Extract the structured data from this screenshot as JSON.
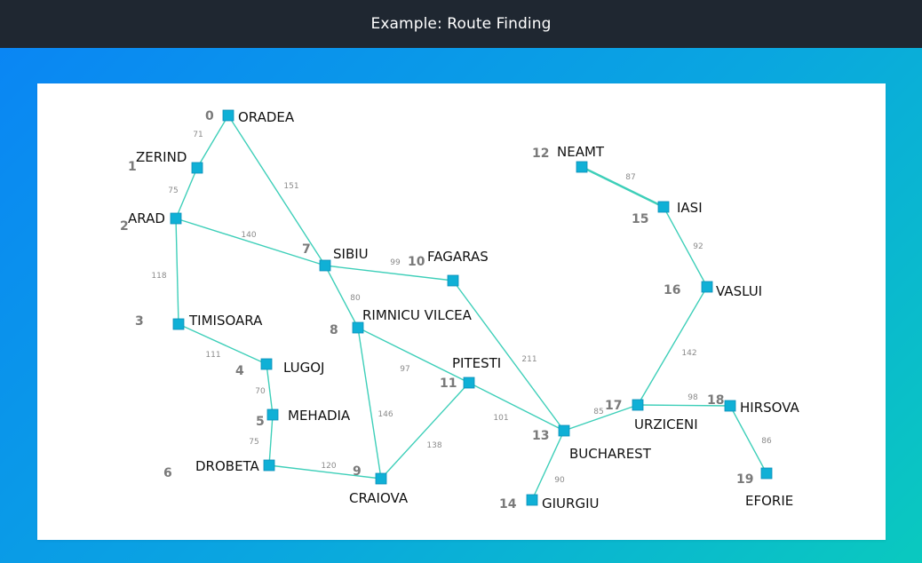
{
  "header": {
    "title": "Example: Route Finding"
  },
  "graph": {
    "nodes": [
      {
        "id": "0",
        "label": "ORADEA"
      },
      {
        "id": "1",
        "label": "ZERIND"
      },
      {
        "id": "2",
        "label": "ARAD"
      },
      {
        "id": "3",
        "label": "TIMISOARA"
      },
      {
        "id": "4",
        "label": "LUGOJ"
      },
      {
        "id": "5",
        "label": "MEHADIA"
      },
      {
        "id": "6",
        "label": "DROBETA"
      },
      {
        "id": "7",
        "label": "SIBIU"
      },
      {
        "id": "8",
        "label": "RIMNICU VILCEA"
      },
      {
        "id": "9",
        "label": "CRAIOVA"
      },
      {
        "id": "10",
        "label": "FAGARAS"
      },
      {
        "id": "11",
        "label": "PITESTI"
      },
      {
        "id": "12",
        "label": "NEAMT"
      },
      {
        "id": "13",
        "label": "BUCHAREST"
      },
      {
        "id": "14",
        "label": "GIURGIU"
      },
      {
        "id": "15",
        "label": "IASI"
      },
      {
        "id": "16",
        "label": "VASLUI"
      },
      {
        "id": "17",
        "label": "URZICENI"
      },
      {
        "id": "18",
        "label": "HIRSOVA"
      },
      {
        "id": "19",
        "label": "EFORIE"
      }
    ],
    "edges": [
      {
        "from": 0,
        "to": 1,
        "weight": "71"
      },
      {
        "from": 1,
        "to": 2,
        "weight": "75"
      },
      {
        "from": 0,
        "to": 7,
        "weight": "151"
      },
      {
        "from": 2,
        "to": 7,
        "weight": "140"
      },
      {
        "from": 2,
        "to": 3,
        "weight": "118"
      },
      {
        "from": 3,
        "to": 4,
        "weight": "111"
      },
      {
        "from": 4,
        "to": 5,
        "weight": "70"
      },
      {
        "from": 5,
        "to": 6,
        "weight": "75"
      },
      {
        "from": 6,
        "to": 9,
        "weight": "120"
      },
      {
        "from": 7,
        "to": 10,
        "weight": "99"
      },
      {
        "from": 7,
        "to": 8,
        "weight": "80"
      },
      {
        "from": 8,
        "to": 11,
        "weight": "97"
      },
      {
        "from": 8,
        "to": 9,
        "weight": "146"
      },
      {
        "from": 9,
        "to": 11,
        "weight": "138"
      },
      {
        "from": 11,
        "to": 13,
        "weight": "101"
      },
      {
        "from": 10,
        "to": 13,
        "weight": "211"
      },
      {
        "from": 13,
        "to": 14,
        "weight": "90"
      },
      {
        "from": 13,
        "to": 17,
        "weight": "85"
      },
      {
        "from": 17,
        "to": 18,
        "weight": "98"
      },
      {
        "from": 18,
        "to": 19,
        "weight": "86"
      },
      {
        "from": 17,
        "to": 16,
        "weight": "142"
      },
      {
        "from": 16,
        "to": 15,
        "weight": "92"
      },
      {
        "from": 15,
        "to": 12,
        "weight": "87"
      }
    ]
  }
}
